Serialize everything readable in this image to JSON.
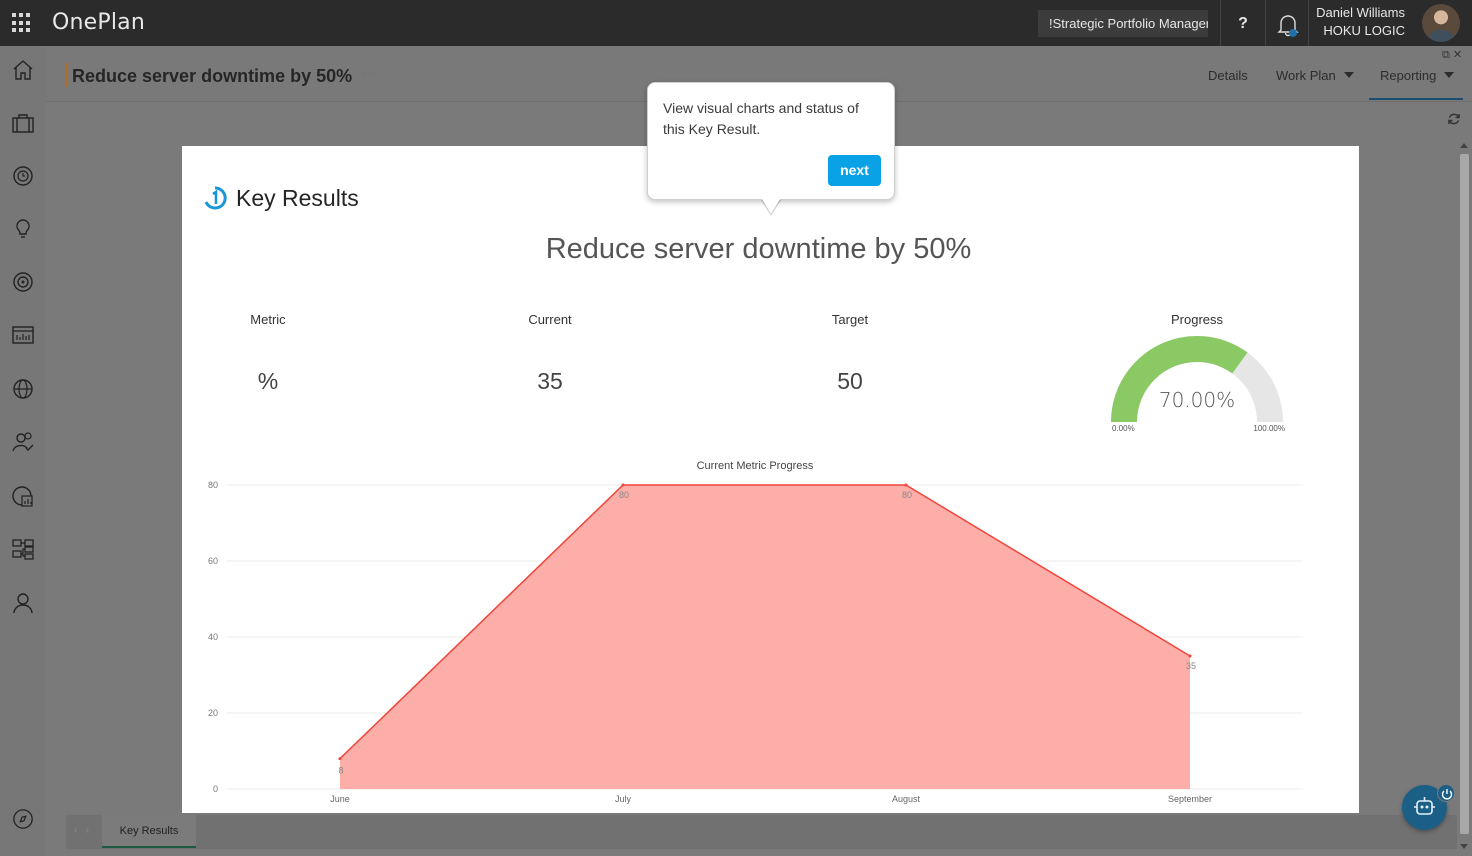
{
  "app": {
    "brand": "OnePlan",
    "portfolio_selector": "!Strategic Portfolio Manager",
    "help_label": "?",
    "user": {
      "name": "Daniel Williams",
      "org": "HOKU LOGIC"
    }
  },
  "sidebar": {
    "items": [
      {
        "name": "home-icon"
      },
      {
        "name": "briefcase-icon"
      },
      {
        "name": "timeline-icon"
      },
      {
        "name": "lightbulb-icon"
      },
      {
        "name": "target-icon"
      },
      {
        "name": "report-icon"
      },
      {
        "name": "globe-icon"
      },
      {
        "name": "team-icon"
      },
      {
        "name": "analytics-icon"
      },
      {
        "name": "hierarchy-icon"
      },
      {
        "name": "person-icon"
      }
    ],
    "bottom_icon": "compass-icon"
  },
  "header": {
    "title": "Reduce server downtime by 50%",
    "ellipsis": "···",
    "tabs": [
      {
        "label": "Details"
      },
      {
        "label": "Work Plan"
      },
      {
        "label": "Reporting"
      }
    ],
    "active_tab": "Reporting"
  },
  "report": {
    "heading": "Key Results",
    "title": "Reduce server downtime by 50%",
    "stats": {
      "metric_label": "Metric",
      "metric_value": "%",
      "current_label": "Current",
      "current_value": "35",
      "target_label": "Target",
      "target_value": "50",
      "progress_label": "Progress"
    },
    "gauge": {
      "value": 0.7,
      "value_text": "70.00%",
      "min_text": "0.00%",
      "max_text": "100.00%",
      "fill_color": "#8bc965",
      "track_color": "#e6e6e6"
    }
  },
  "chart_data": {
    "type": "area",
    "title": "Current Metric Progress",
    "categories": [
      "June",
      "July",
      "August",
      "September"
    ],
    "series": [
      {
        "values": [
          8,
          80,
          80,
          35
        ],
        "line_color": "#f0453a",
        "fill_color": "#fdaea9"
      }
    ],
    "ylim": [
      0,
      80
    ],
    "yticks": [
      0,
      20,
      40,
      60,
      80
    ],
    "data_labels": [
      "8",
      "80",
      "80",
      "35"
    ],
    "grid": true
  },
  "tooltip": {
    "text": "View visual charts and status of this Key Result.",
    "next_label": "next"
  },
  "bottom": {
    "tab_label": "Key Results",
    "nav_prev": "‹",
    "nav_next": "›"
  }
}
